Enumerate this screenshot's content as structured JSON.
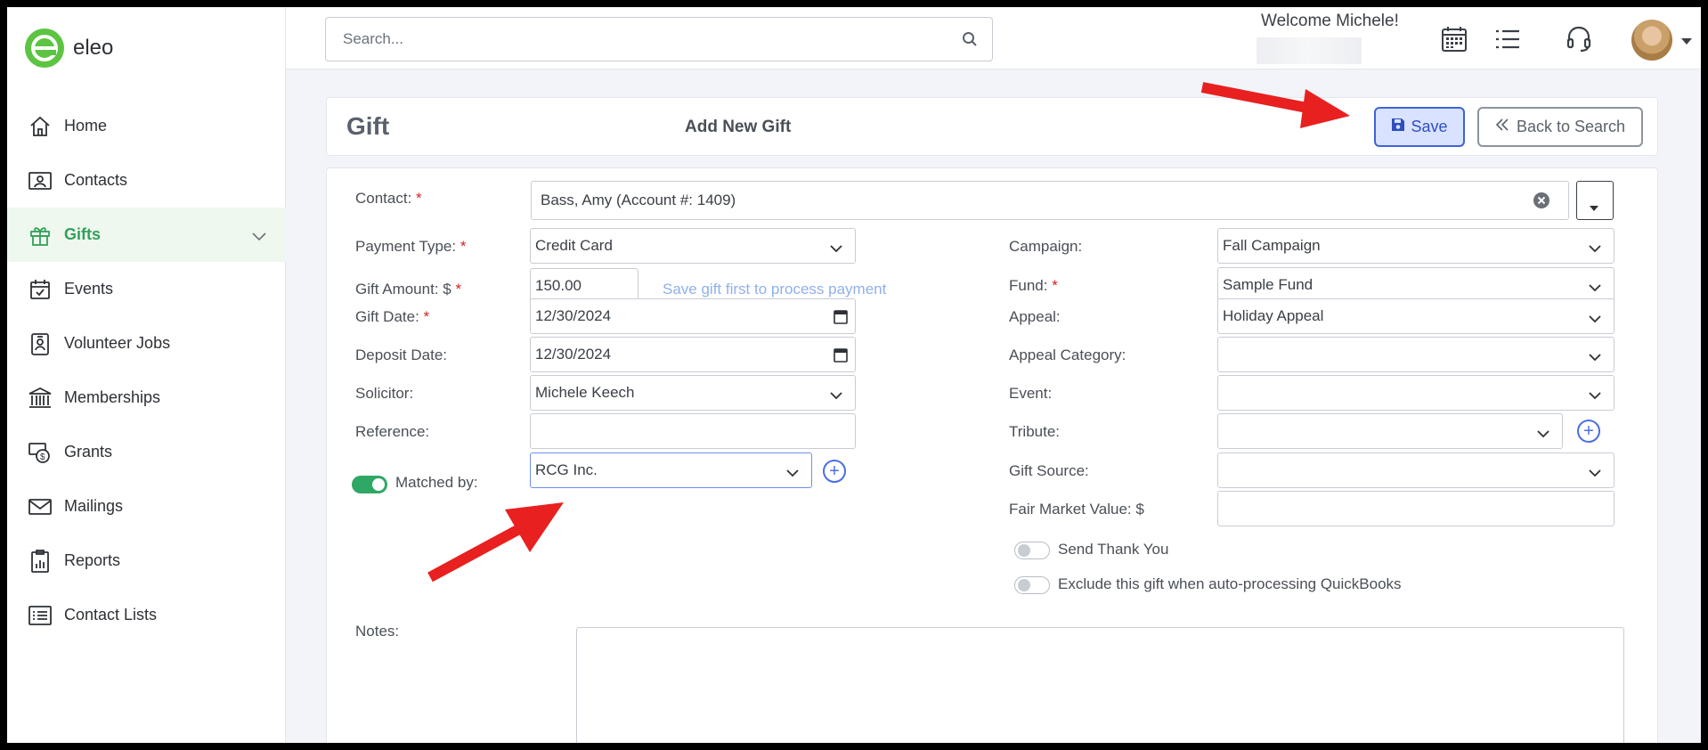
{
  "app": {
    "name": "eleo"
  },
  "sidebar": {
    "items": [
      {
        "label": "Home",
        "icon": "home-icon"
      },
      {
        "label": "Contacts",
        "icon": "contact-card-icon"
      },
      {
        "label": "Gifts",
        "icon": "gift-icon",
        "active": true
      },
      {
        "label": "Events",
        "icon": "calendar-check-icon"
      },
      {
        "label": "Volunteer Jobs",
        "icon": "badge-icon"
      },
      {
        "label": "Memberships",
        "icon": "building-icon"
      },
      {
        "label": "Grants",
        "icon": "money-icon"
      },
      {
        "label": "Mailings",
        "icon": "mail-icon"
      },
      {
        "label": "Reports",
        "icon": "clipboard-chart-icon"
      },
      {
        "label": "Contact Lists",
        "icon": "list-icon"
      }
    ]
  },
  "topbar": {
    "search_placeholder": "Search...",
    "welcome": "Welcome Michele!"
  },
  "header": {
    "title": "Gift",
    "subtitle": "Add New Gift",
    "save_label": "Save",
    "back_label": "Back to Search"
  },
  "form": {
    "contact": {
      "label": "Contact:",
      "value": "Bass, Amy (Account #: 1409)"
    },
    "payment_type": {
      "label": "Payment Type:",
      "value": "Credit Card"
    },
    "gift_amount": {
      "label": "Gift Amount: $",
      "value": "150.00",
      "hint": "Save gift first to process payment"
    },
    "gift_date": {
      "label": "Gift Date:",
      "value": "12/30/2024"
    },
    "deposit_date": {
      "label": "Deposit Date:",
      "value": "12/30/2024"
    },
    "solicitor": {
      "label": "Solicitor:",
      "value": "Michele Keech"
    },
    "reference": {
      "label": "Reference:",
      "value": ""
    },
    "matched_by": {
      "label": "Matched by:",
      "value": "RCG Inc.",
      "toggle_on": true
    },
    "campaign": {
      "label": "Campaign:",
      "value": "Fall Campaign"
    },
    "fund": {
      "label": "Fund:",
      "value": "Sample Fund"
    },
    "appeal": {
      "label": "Appeal:",
      "value": "Holiday Appeal"
    },
    "appeal_category": {
      "label": "Appeal Category:",
      "value": ""
    },
    "event": {
      "label": "Event:",
      "value": ""
    },
    "tribute": {
      "label": "Tribute:",
      "value": ""
    },
    "gift_source": {
      "label": "Gift Source:",
      "value": ""
    },
    "fair_market_value": {
      "label": "Fair Market Value: $",
      "value": ""
    },
    "send_thank_you": {
      "label": "Send Thank You",
      "on": false
    },
    "exclude_quickbooks": {
      "label": "Exclude this gift when auto-processing QuickBooks",
      "on": false
    },
    "notes": {
      "label": "Notes:",
      "value": ""
    },
    "required_mark": "*"
  },
  "colors": {
    "brand_green": "#5cc442",
    "active_green": "#34a05a",
    "accent_blue": "#3f63d6",
    "annotation_red": "#e8201f"
  }
}
